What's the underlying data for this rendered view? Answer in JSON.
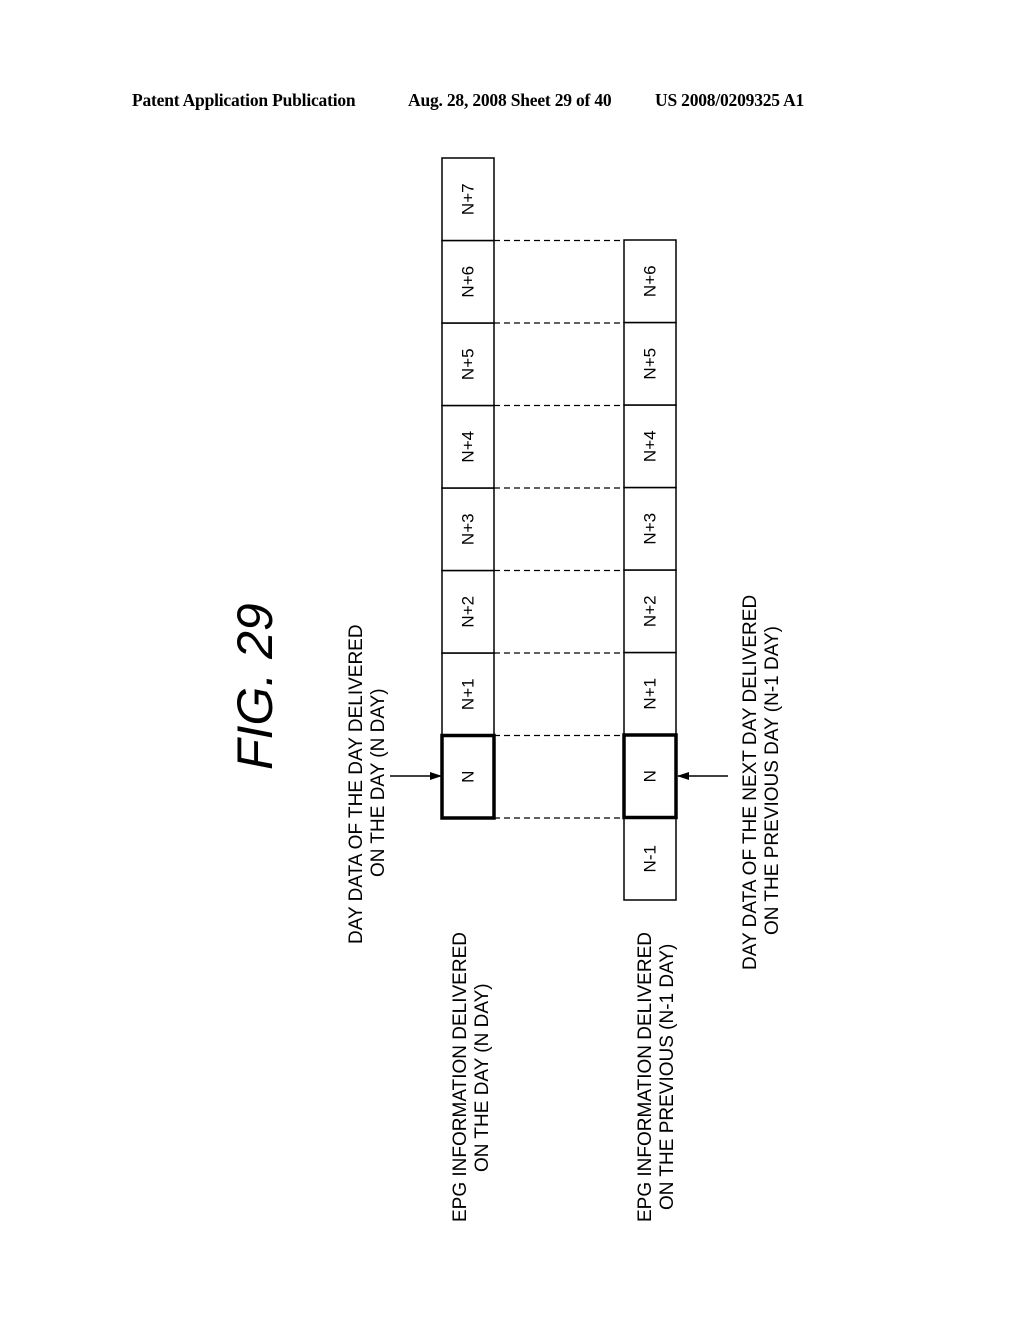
{
  "header": {
    "publication": "Patent Application Publication",
    "date_sheet": "Aug. 28, 2008  Sheet 29 of 40",
    "patent_number": "US 2008/0209325 A1"
  },
  "figure": {
    "title": "FIG.  29",
    "row_a": {
      "label_line1": "EPG INFORMATION DELIVERED",
      "label_line2": "ON THE DAY (N DAY)",
      "cells": [
        "N",
        "N+1",
        "N+2",
        "N+3",
        "N+4",
        "N+5",
        "N+6",
        "N+7"
      ],
      "highlighted": "N"
    },
    "row_b": {
      "label_line1": "EPG INFORMATION DELIVERED",
      "label_line2": "ON THE PREVIOUS (N-1 DAY)",
      "cells": [
        "N-1",
        "N",
        "N+1",
        "N+2",
        "N+3",
        "N+4",
        "N+5",
        "N+6"
      ],
      "highlighted": "N"
    },
    "annotation_a": {
      "line1": "DAY DATA OF THE DAY DELIVERED",
      "line2": "ON THE DAY (N DAY)"
    },
    "annotation_b": {
      "line1": "DAY DATA OF THE NEXT DAY DELIVERED",
      "line2": "ON THE PREVIOUS DAY (N-1 DAY)"
    }
  }
}
